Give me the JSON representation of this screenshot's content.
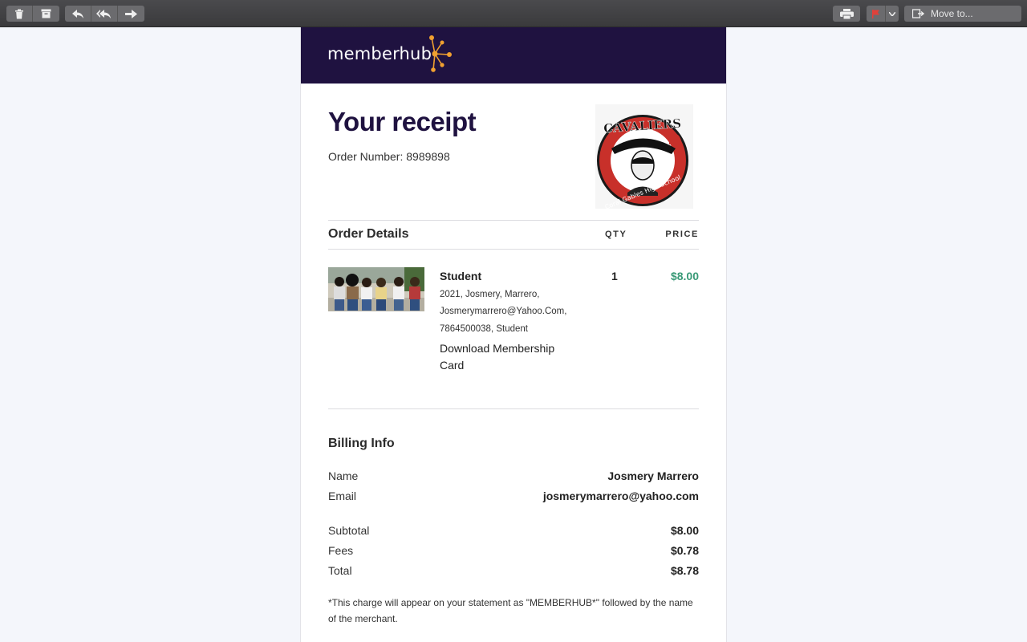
{
  "toolbar": {
    "move_to_label": "Move to...",
    "icons": [
      "trash-icon",
      "archive-icon",
      "reply-icon",
      "reply-all-icon",
      "forward-icon",
      "print-icon",
      "flag-icon",
      "chevron-down-icon",
      "folder-move-icon"
    ],
    "flag_color": "#e0413a"
  },
  "brand": {
    "name": "memberhub",
    "bar_color": "#1f1240",
    "accent_color": "#f0a030"
  },
  "receipt": {
    "title": "Your receipt",
    "order_number": "Order Number: 8989898",
    "order_details_heading": "Order Details",
    "qty_header": "QTY",
    "price_header": "PRICE",
    "item": {
      "name": "Student",
      "details": [
        "2021, Josmery, Marrero,",
        "Josmerymarrero@Yahoo.Com,",
        "7864500038, Student"
      ],
      "link": "Download Membership Card",
      "qty": "1",
      "price": "$8.00"
    },
    "billing": {
      "heading": "Billing Info",
      "name_label": "Name",
      "name_value": "Josmery Marrero",
      "email_label": "Email",
      "email_value": "josmerymarrero@yahoo.com",
      "subtotal_label": "Subtotal",
      "subtotal_value": "$8.00",
      "fees_label": "Fees",
      "fees_value": "$0.78",
      "total_label": "Total",
      "total_value": "$8.78"
    },
    "note": "*This charge will appear on your statement as \"MEMBERHUB*\" followed by the name of the merchant.",
    "price_color": "#3a9a77"
  },
  "school_seal": {
    "top_text": "CAVALIERS",
    "ring_text": "Coral Gables High School"
  }
}
